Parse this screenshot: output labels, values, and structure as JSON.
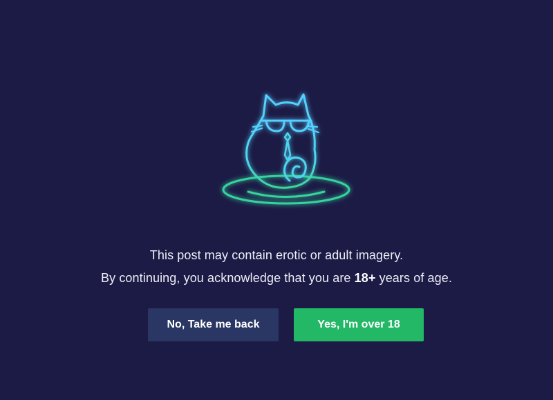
{
  "mascot": {
    "icon": "neon-cat-icon",
    "colors": {
      "outline": "#56cfff",
      "glow": "#2f8cff",
      "base": "#35d39e"
    }
  },
  "message": {
    "line_1": "This post may contain erotic or adult imagery.",
    "line_2_before": "By continuing, you acknowledge that you are ",
    "line_2_emphasis": "18+",
    "line_2_after": " years of age."
  },
  "buttons": {
    "back_label": "No, Take me back",
    "confirm_label": "Yes, I'm over 18"
  },
  "colors": {
    "background": "#1c1b45",
    "back_button": "#2a3663",
    "confirm_button": "#23b866"
  }
}
